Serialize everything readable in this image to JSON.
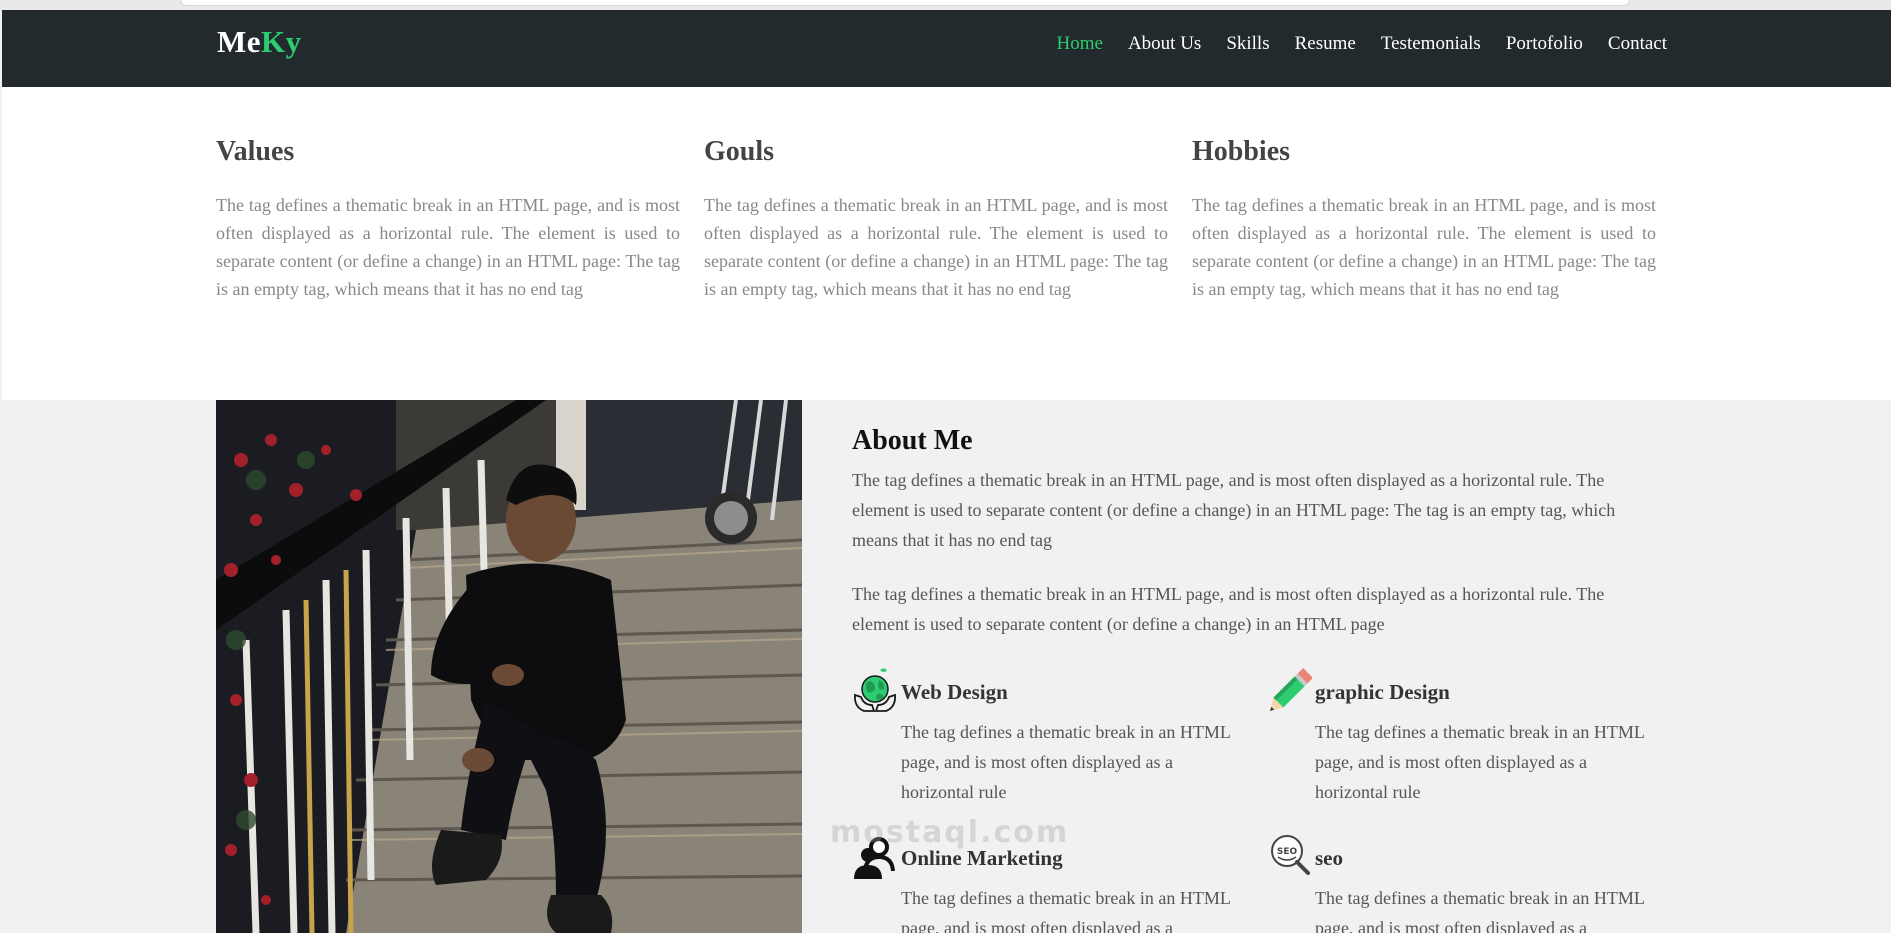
{
  "brand": {
    "part1": "Me",
    "part2": "Ky"
  },
  "nav": {
    "home": "Home",
    "about": "About Us",
    "skills": "Skills",
    "resume": "Resume",
    "testimonials": "Testemonials",
    "portfolio": "Portofolio",
    "contact": "Contact"
  },
  "values_section": {
    "col1": {
      "title": "Values",
      "text": "The tag defines a thematic break in an HTML page, and is most often displayed as a horizontal rule. The element is used to separate content (or define a change) in an HTML page: The tag is an empty tag, which means that it has no end tag"
    },
    "col2": {
      "title": "Gouls",
      "text": "The tag defines a thematic break in an HTML page, and is most often displayed as a horizontal rule. The element is used to separate content (or define a change) in an HTML page: The tag is an empty tag, which means that it has no end tag"
    },
    "col3": {
      "title": "Hobbies",
      "text": "The tag defines a thematic break in an HTML page, and is most often displayed as a horizontal rule. The element is used to separate content (or define a change) in an HTML page: The tag is an empty tag, which means that it has no end tag"
    }
  },
  "about": {
    "title": "About Me",
    "para1": "The tag defines a thematic break in an HTML page, and is most often displayed as a horizontal rule. The element is used to separate content (or define a change) in an HTML page: The tag is an empty tag, which means that it has no end tag",
    "para2": "The tag defines a thematic break in an HTML page, and is most often displayed as a horizontal rule. The element is used to separate content (or define a change) in an HTML page"
  },
  "services": {
    "web": {
      "title": "Web Design",
      "text": "The tag defines a thematic break in an HTML page, and is most often displayed as a horizontal rule",
      "icon": "globe-hands-icon"
    },
    "graphic": {
      "title": "graphic Design",
      "text": "The tag defines a thematic break in an HTML page, and is most often displayed as a horizontal rule",
      "icon": "pencil-icon"
    },
    "marketing": {
      "title": "Online Marketing",
      "text": "The tag defines a thematic break in an HTML page, and is most often displayed as a horizontal rule",
      "icon": "user-group-icon"
    },
    "seo": {
      "title": "seo",
      "text": "The tag defines a thematic break in an HTML page, and is most often displayed as a horizontal rule",
      "icon": "seo-magnifier-icon"
    }
  },
  "watermark": "mostaql.com",
  "colors": {
    "accent": "#2ecc71",
    "navbar": "#222a2d",
    "section_bg": "#f1f1f1"
  }
}
